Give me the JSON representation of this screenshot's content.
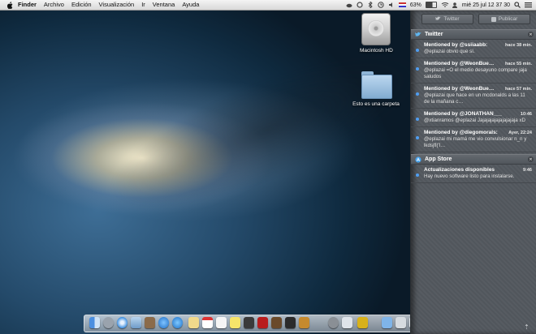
{
  "menubar": {
    "app": "Finder",
    "items": [
      "Archivo",
      "Edición",
      "Visualización",
      "Ir",
      "Ventana",
      "Ayuda"
    ],
    "battery": "63%",
    "clock": "mié 25 jul  12 37 30"
  },
  "desktop": {
    "drive_label": "Macintosh HD",
    "folder_label": "Esto es una carpeta"
  },
  "notification_center": {
    "share_buttons": [
      "Twitter",
      "Publicar"
    ],
    "sections": [
      {
        "name": "Twitter",
        "notifications": [
          {
            "title": "Mentioned by @ssiiaabb:",
            "time": "hace 38 min.",
            "body": "@eplazai obvio que sí."
          },
          {
            "title": "Mentioned by @WeonBue…",
            "time": "hace 55 min.",
            "body": "@eplazai =O el medio desayuno compare jaja saludos"
          },
          {
            "title": "Mentioned by @WeonBue…",
            "time": "hace 57 min.",
            "body": "@eplazai que hace en un mcdonalds a las 11 de la mañana c…"
          },
          {
            "title": "Mentioned by @JONATHAN___M:",
            "time": "10:46",
            "body": "@xtianramos @eplazai Jajajajajajajajajaja xD"
          },
          {
            "title": "Mentioned by @diegomorals:",
            "time": "Ayer, 22:24",
            "body": "@eplazai mi mamá me vio convulsionar n_n y lkdsjfl('l…"
          }
        ]
      },
      {
        "name": "App Store",
        "notifications": [
          {
            "title": "Actualizaciones disponibles",
            "time": "9:46",
            "body": "Hay nuevo software listo para instalarse."
          }
        ]
      }
    ]
  },
  "colors": {
    "accent_blue": "#4f9df0",
    "panel_bg": "#53585e"
  }
}
